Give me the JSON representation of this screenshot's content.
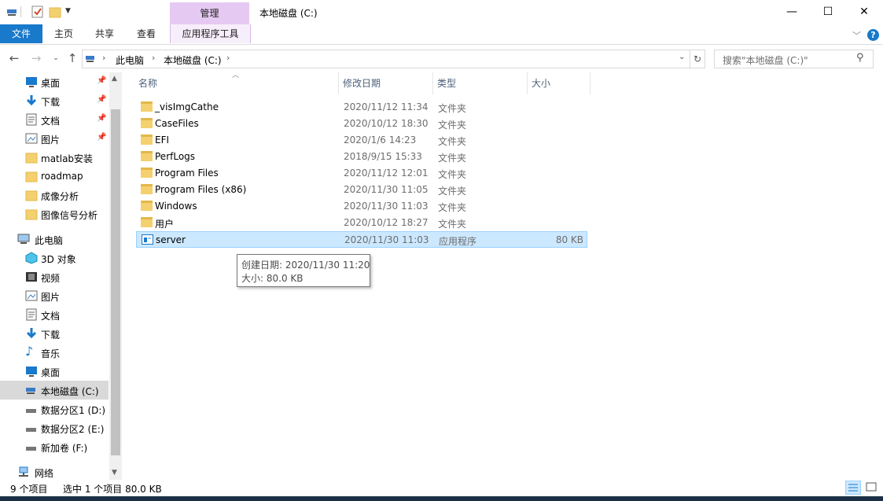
{
  "window": {
    "title": "本地磁盘 (C:)",
    "context_tab": "管理",
    "minimize": "—",
    "maximize": "☐",
    "close": "✕"
  },
  "ribbon": {
    "tabs": [
      "文件",
      "主页",
      "共享",
      "查看",
      "应用程序工具"
    ],
    "collapse_icon": "chevron-down-icon",
    "help_icon": "help-icon"
  },
  "address": {
    "path": [
      "此电脑",
      "本地磁盘 (C:)"
    ],
    "search_placeholder": "搜索\"本地磁盘 (C:)\""
  },
  "sidebar": {
    "quick_access": [
      {
        "label": "桌面",
        "icon": "desktop-icon",
        "pinned": true
      },
      {
        "label": "下载",
        "icon": "download-icon",
        "pinned": true
      },
      {
        "label": "文档",
        "icon": "documents-icon",
        "pinned": true
      },
      {
        "label": "图片",
        "icon": "pictures-icon",
        "pinned": true
      },
      {
        "label": "matlab安装",
        "icon": "folder-icon",
        "pinned": false
      },
      {
        "label": "roadmap",
        "icon": "folder-icon",
        "pinned": false
      },
      {
        "label": "成像分析",
        "icon": "folder-icon",
        "pinned": false
      },
      {
        "label": "图像信号分析",
        "icon": "folder-icon",
        "pinned": false
      }
    ],
    "this_pc": "此电脑",
    "pc_items": [
      {
        "label": "3D 对象",
        "icon": "3d-objects-icon"
      },
      {
        "label": "视频",
        "icon": "videos-icon"
      },
      {
        "label": "图片",
        "icon": "pictures-icon"
      },
      {
        "label": "文档",
        "icon": "documents-icon"
      },
      {
        "label": "下载",
        "icon": "download-icon"
      },
      {
        "label": "音乐",
        "icon": "music-icon"
      },
      {
        "label": "桌面",
        "icon": "desktop-icon"
      },
      {
        "label": "本地磁盘 (C:)",
        "icon": "local-disk-icon",
        "selected": true
      },
      {
        "label": "数据分区1 (D:)",
        "icon": "drive-icon"
      },
      {
        "label": "数据分区2 (E:)",
        "icon": "drive-icon"
      },
      {
        "label": "新加卷 (F:)",
        "icon": "drive-icon"
      }
    ],
    "network": "网络"
  },
  "columns": {
    "name": "名称",
    "date": "修改日期",
    "type": "类型",
    "size": "大小"
  },
  "files": [
    {
      "name": "_visImgCathe",
      "date": "2020/11/12 11:34",
      "type": "文件夹",
      "size": ""
    },
    {
      "name": "CaseFiles",
      "date": "2020/10/12 18:30",
      "type": "文件夹",
      "size": ""
    },
    {
      "name": "EFI",
      "date": "2020/1/6 14:23",
      "type": "文件夹",
      "size": ""
    },
    {
      "name": "PerfLogs",
      "date": "2018/9/15 15:33",
      "type": "文件夹",
      "size": ""
    },
    {
      "name": "Program Files",
      "date": "2020/11/12 12:01",
      "type": "文件夹",
      "size": ""
    },
    {
      "name": "Program Files (x86)",
      "date": "2020/11/30 11:05",
      "type": "文件夹",
      "size": ""
    },
    {
      "name": "Windows",
      "date": "2020/11/30 11:03",
      "type": "文件夹",
      "size": ""
    },
    {
      "name": "用户",
      "date": "2020/10/12 18:27",
      "type": "文件夹",
      "size": ""
    },
    {
      "name": "server",
      "date": "2020/11/30 11:03",
      "type": "应用程序",
      "size": "80 KB",
      "selected": true
    }
  ],
  "tooltip": {
    "created": "创建日期: 2020/11/30 11:20",
    "size": "大小: 80.0 KB"
  },
  "status": {
    "count": "9 个项目",
    "selection": "选中 1 个项目  80.0 KB"
  },
  "colors": {
    "file_tab": "#1979ca",
    "context_tab": "#e6c9f2",
    "selection": "#cce8ff",
    "folder": "#f4d06f"
  }
}
